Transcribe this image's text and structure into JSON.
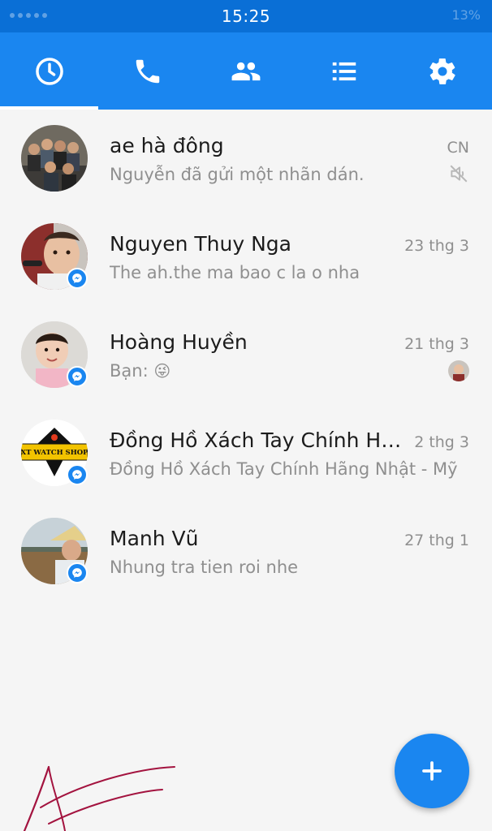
{
  "status_bar": {
    "time": "15:25",
    "right_text": "13%"
  },
  "tabs": [
    {
      "name": "recent",
      "icon": "clock-icon",
      "active": true
    },
    {
      "name": "calls",
      "icon": "phone-icon",
      "active": false
    },
    {
      "name": "people",
      "icon": "people-icon",
      "active": false
    },
    {
      "name": "groups",
      "icon": "list-icon",
      "active": false
    },
    {
      "name": "settings",
      "icon": "gear-icon",
      "active": false
    }
  ],
  "conversations": [
    {
      "name": "ae hà đông",
      "snippet": "Nguyễn đã gửi một nhãn dán.",
      "time": "CN",
      "muted": true
    },
    {
      "name": "Nguyen Thuy Nga",
      "snippet": "The ah.the ma bao c la o nha",
      "time": "23 thg 3"
    },
    {
      "name": "Hoàng Huyền",
      "snippet": "Bạn: ",
      "time": "21 thg 3",
      "seen": true
    },
    {
      "name": "Đồng Hồ Xách Tay Chính Hãng Nhật - Mỹ",
      "snippet": "Đồng Hồ Xách Tay Chính Hãng Nhật - Mỹ",
      "time": "2 thg 3",
      "logo_text": "XT WATCH SHOP"
    },
    {
      "name": "Manh Vũ",
      "snippet": "Nhung tra tien roi nhe",
      "time": "27 thg 1"
    }
  ],
  "colors": {
    "primary": "#1a86f0",
    "status_bar": "#0a6fd6",
    "background": "#f5f5f5"
  }
}
